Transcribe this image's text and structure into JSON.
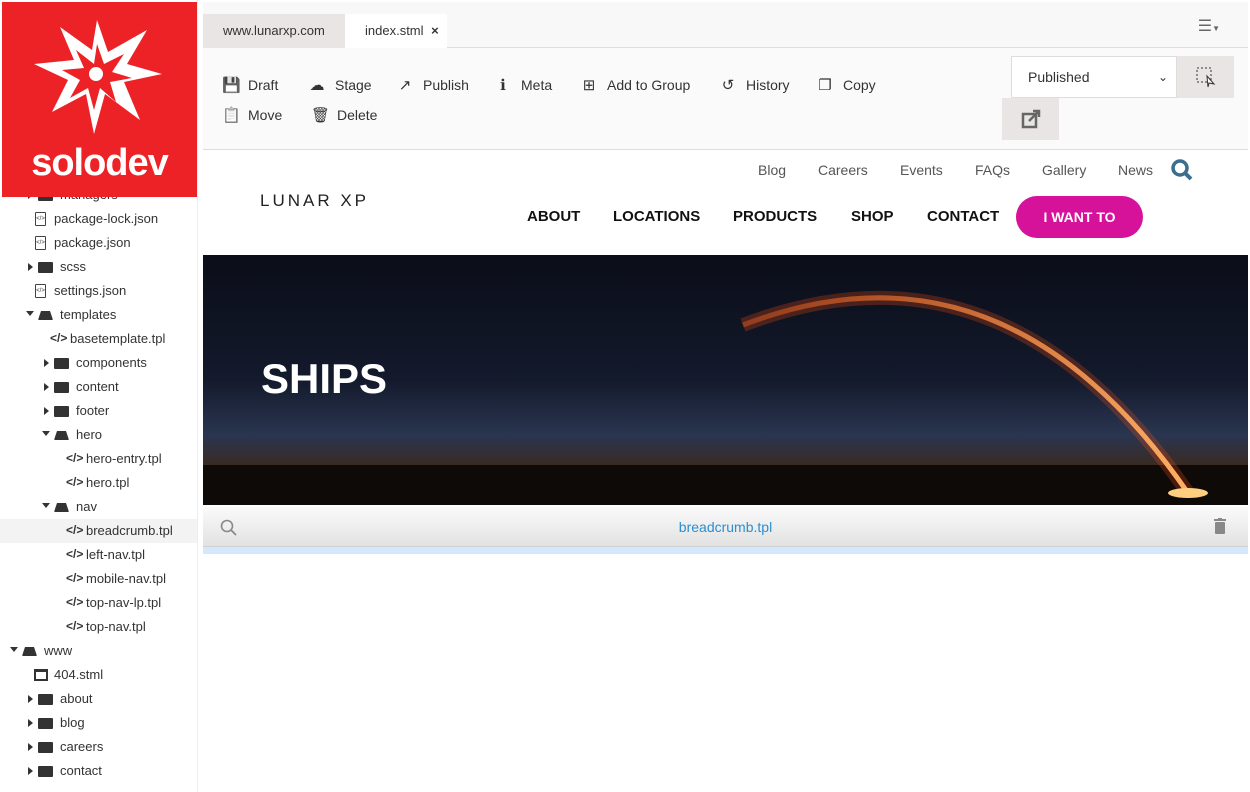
{
  "brand": {
    "name": "solodev",
    "color": "#ec2227"
  },
  "tabs": [
    {
      "label": "www.lunarxp.com"
    },
    {
      "label": "index.stml",
      "close": "×"
    }
  ],
  "toolbar": {
    "buttons": [
      {
        "label": "Draft",
        "icon": "save-icon"
      },
      {
        "label": "Stage",
        "icon": "cloud-upload-icon"
      },
      {
        "label": "Publish",
        "icon": "share-icon"
      },
      {
        "label": "Meta",
        "icon": "info-icon"
      },
      {
        "label": "Add to Group",
        "icon": "plus-square-icon"
      },
      {
        "label": "History",
        "icon": "history-icon"
      },
      {
        "label": "Copy",
        "icon": "copy-icon"
      },
      {
        "label": "Move",
        "icon": "paste-icon"
      },
      {
        "label": "Delete",
        "icon": "trash-icon"
      }
    ],
    "status_select": "Published"
  },
  "tree": [
    {
      "label": "managers",
      "type": "folder",
      "level": 1,
      "open": false
    },
    {
      "label": "package-lock.json",
      "type": "file",
      "level": 1
    },
    {
      "label": "package.json",
      "type": "file",
      "level": 1
    },
    {
      "label": "scss",
      "type": "folder",
      "level": 1,
      "open": false
    },
    {
      "label": "settings.json",
      "type": "file",
      "level": 1
    },
    {
      "label": "templates",
      "type": "folder",
      "level": 1,
      "open": true
    },
    {
      "label": "basetemplate.tpl",
      "type": "code",
      "level": 2
    },
    {
      "label": "components",
      "type": "folder",
      "level": 2,
      "open": false
    },
    {
      "label": "content",
      "type": "folder",
      "level": 2,
      "open": false
    },
    {
      "label": "footer",
      "type": "folder",
      "level": 2,
      "open": false
    },
    {
      "label": "hero",
      "type": "folder",
      "level": 2,
      "open": true
    },
    {
      "label": "hero-entry.tpl",
      "type": "code",
      "level": 3
    },
    {
      "label": "hero.tpl",
      "type": "code",
      "level": 3
    },
    {
      "label": "nav",
      "type": "folder",
      "level": 2,
      "open": true
    },
    {
      "label": "breadcrumb.tpl",
      "type": "code",
      "level": 3,
      "selected": true
    },
    {
      "label": "left-nav.tpl",
      "type": "code",
      "level": 3
    },
    {
      "label": "mobile-nav.tpl",
      "type": "code",
      "level": 3
    },
    {
      "label": "top-nav-lp.tpl",
      "type": "code",
      "level": 3
    },
    {
      "label": "top-nav.tpl",
      "type": "code",
      "level": 3
    },
    {
      "label": "www",
      "type": "folder",
      "level": 0,
      "open": true
    },
    {
      "label": "404.stml",
      "type": "page",
      "level": 1
    },
    {
      "label": "about",
      "type": "folder",
      "level": 1,
      "open": false
    },
    {
      "label": "blog",
      "type": "folder",
      "level": 1,
      "open": false
    },
    {
      "label": "careers",
      "type": "folder",
      "level": 1,
      "open": false
    },
    {
      "label": "contact",
      "type": "folder",
      "level": 1,
      "open": false
    }
  ],
  "site": {
    "logo": "LUNAR XP",
    "utility_nav": [
      "Blog",
      "Careers",
      "Events",
      "FAQs",
      "Gallery",
      "News"
    ],
    "main_nav": [
      "ABOUT",
      "LOCATIONS",
      "PRODUCTS",
      "SHOP",
      "CONTACT"
    ],
    "cta": "I WANT TO",
    "cta_color": "#d6119a",
    "hero_title": "SHIPS",
    "breadcrumb_block": "breadcrumb.tpl"
  }
}
